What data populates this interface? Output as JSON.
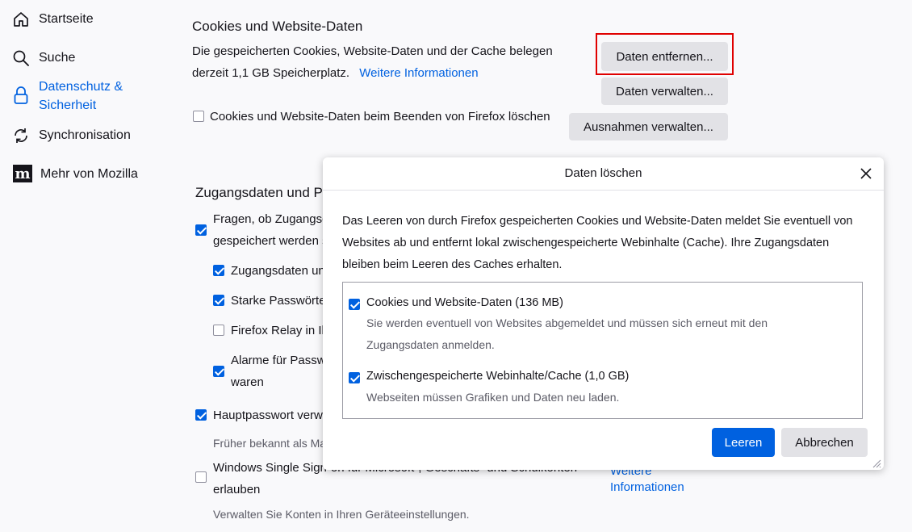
{
  "sidebar": {
    "items": [
      {
        "label": "Startseite",
        "icon": "home-icon"
      },
      {
        "label": "Suche",
        "icon": "search-icon"
      },
      {
        "label": "Datenschutz &",
        "label2": "Sicherheit",
        "icon": "lock-icon"
      },
      {
        "label": "Synchronisation",
        "icon": "sync-icon"
      },
      {
        "label": "Mehr von Mozilla",
        "icon": "mozilla-icon"
      }
    ]
  },
  "cookies": {
    "heading": "Cookies und Website-Daten",
    "desc_line1": "Die gespeicherten Cookies, Website-Daten und der Cache belegen",
    "desc_line2": "derzeit 1,1 GB Speicherplatz.",
    "more_info": "Weitere Informationen",
    "remove_btn": "Daten entfernen...",
    "manage_btn": "Daten verwalten...",
    "exceptions_btn": "Ausnahmen verwalten...",
    "delete_on_close": "Cookies und Website-Daten beim Beenden von Firefox löschen"
  },
  "logins": {
    "heading": "Zugangsdaten und P",
    "ask_line1": "Fragen, ob Zugangsd",
    "ask_line2": "gespeichert werden s",
    "autofill": "Zugangsdaten un",
    "strong": "Starke Passwörter",
    "relay": "Firefox Relay in Ih",
    "alerts_line1": "Alarme für Passw",
    "alerts_line2": "waren",
    "primary": "Hauptpasswort verw",
    "primary_sub": "Früher bekannt als Ma",
    "windows_sso_line1": "Windows Single Sign-on für Microsoft-, Geschäfts- und Schulkonten",
    "windows_sso_line2": "erlauben",
    "windows_sso_sub": "Verwalten Sie Konten in Ihren Geräteeinstellungen.",
    "more_info_line1": "Weitere",
    "more_info_line2": "Informationen"
  },
  "dialog": {
    "title": "Daten löschen",
    "desc_line1": "Das Leeren von durch Firefox gespeicherten Cookies und Website-Daten meldet Sie eventuell von",
    "desc_line2": "Websites ab und entfernt lokal zwischengespeicherte Webinhalte (Cache). Ihre Zugangsdaten",
    "desc_line3": "bleiben beim Leeren des Caches erhalten.",
    "opt1_label": "Cookies und Website-Daten (136 MB)",
    "opt1_desc1": "Sie werden eventuell von Websites abgemeldet und müssen sich erneut mit den",
    "opt1_desc2": "Zugangsdaten anmelden.",
    "opt2_label": "Zwischengespeicherte Webinhalte/Cache (1,0 GB)",
    "opt2_desc": "Webseiten müssen Grafiken und Daten neu laden.",
    "clear_btn": "Leeren",
    "cancel_btn": "Abbrechen"
  },
  "colors": {
    "accent": "#0061e0",
    "highlight": "#e00000"
  }
}
